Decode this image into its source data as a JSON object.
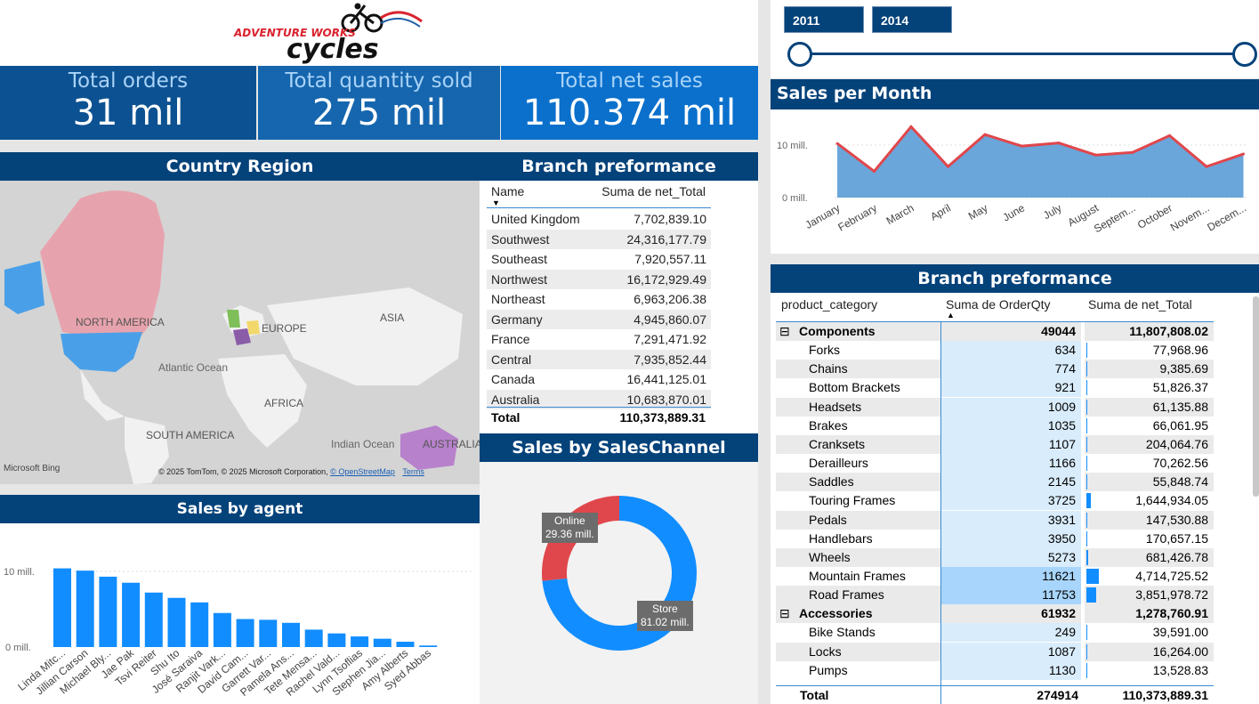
{
  "logo": {
    "line1": "ADVENTURE WORKS",
    "line2": "cycles"
  },
  "kpis": [
    {
      "title": "Total orders",
      "value": "31 mil"
    },
    {
      "title": "Total quantity sold",
      "value": "275 mil"
    },
    {
      "title": "Total net sales",
      "value": "110.374 mil"
    }
  ],
  "map": {
    "title": "Country Region",
    "labels": [
      "NORTH AMERICA",
      "EUROPE",
      "ASIA",
      "Atlantic Ocean",
      "AFRICA",
      "SOUTH AMERICA",
      "Indian Ocean",
      "AUSTRALIA"
    ],
    "bing": "Microsoft Bing",
    "copyright": "© 2025 TomTom, © 2025 Microsoft Corporation,",
    "osm": "© OpenStreetMap",
    "terms": "Terms"
  },
  "branch_table": {
    "title": "Branch preformance",
    "headers": [
      "Name",
      "Suma de net_Total"
    ],
    "rows": [
      [
        "United Kingdom",
        "7,702,839.10"
      ],
      [
        "Southwest",
        "24,316,177.79"
      ],
      [
        "Southeast",
        "7,920,557.11"
      ],
      [
        "Northwest",
        "16,172,929.49"
      ],
      [
        "Northeast",
        "6,963,206.38"
      ],
      [
        "Germany",
        "4,945,860.07"
      ],
      [
        "France",
        "7,291,471.92"
      ],
      [
        "Central",
        "7,935,852.44"
      ],
      [
        "Canada",
        "16,441,125.01"
      ],
      [
        "Australia",
        "10,683,870.01"
      ]
    ],
    "total_label": "Total",
    "total_value": "110,373,889.31"
  },
  "slicer": {
    "from": "2011",
    "to": "2014"
  },
  "agents": {
    "title": "Sales by agent",
    "ytick_top": "10 mill.",
    "ytick_bottom": "0 mill.",
    "names": [
      "Linda Mitc...",
      "Jillian Carson",
      "Michael Bly...",
      "Jae Pak",
      "Tsvi Reiter",
      "Shu Ito",
      "José Saraiva",
      "Ranjit Vark...",
      "David Cam...",
      "Garrett Var...",
      "Pamela Ans...",
      "Tete Mensa...",
      "Rachel Vald...",
      "Lynn Tsoflias",
      "Stephen Jia...",
      "Amy Alberts",
      "Syed Abbas"
    ]
  },
  "channel": {
    "title": "Sales by SalesChannel",
    "online_label": "Online",
    "online_value": "29.36 mill.",
    "store_label": "Store",
    "store_value": "81.02 mill."
  },
  "monthly": {
    "title": "Sales per Month",
    "ytick_top": "10 mill.",
    "ytick_bottom": "0 mill.",
    "months": [
      "January",
      "February",
      "March",
      "April",
      "May",
      "June",
      "July",
      "August",
      "Septem...",
      "October",
      "Novem...",
      "Decem..."
    ]
  },
  "category_table": {
    "title": "Branch preformance",
    "headers": [
      "product_category",
      "Suma de OrderQty",
      "Suma de net_Total"
    ],
    "groups": [
      {
        "name": "Components",
        "qty": "49044",
        "total": "11,807,808.02",
        "items": [
          [
            "Forks",
            "634",
            "77,968.96"
          ],
          [
            "Chains",
            "774",
            "9,385.69"
          ],
          [
            "Bottom Brackets",
            "921",
            "51,826.37"
          ],
          [
            "Headsets",
            "1009",
            "61,135.88"
          ],
          [
            "Brakes",
            "1035",
            "66,061.95"
          ],
          [
            "Cranksets",
            "1107",
            "204,064.76"
          ],
          [
            "Derailleurs",
            "1166",
            "70,262.56"
          ],
          [
            "Saddles",
            "2145",
            "55,848.74"
          ],
          [
            "Touring Frames",
            "3725",
            "1,644,934.05"
          ],
          [
            "Pedals",
            "3931",
            "147,530.88"
          ],
          [
            "Handlebars",
            "3950",
            "170,657.15"
          ],
          [
            "Wheels",
            "5273",
            "681,426.78"
          ],
          [
            "Mountain Frames",
            "11621",
            "4,714,725.52"
          ],
          [
            "Road Frames",
            "11753",
            "3,851,978.72"
          ]
        ]
      },
      {
        "name": "Accessories",
        "qty": "61932",
        "total": "1,278,760.91",
        "items": [
          [
            "Bike Stands",
            "249",
            "39,591.00"
          ],
          [
            "Locks",
            "1087",
            "16,264.00"
          ],
          [
            "Pumps",
            "1130",
            "13,528.83"
          ]
        ]
      }
    ],
    "total_label": "Total",
    "total_qty": "274914",
    "total_value": "110,373,889.31"
  },
  "chart_data": [
    {
      "type": "bar",
      "title": "Sales by agent",
      "categories": [
        "Linda Mitc...",
        "Jillian Carson",
        "Michael Bly...",
        "Jae Pak",
        "Tsvi Reiter",
        "Shu Ito",
        "José Saraiva",
        "Ranjit Vark...",
        "David Cam...",
        "Garrett Var...",
        "Pamela Ans...",
        "Tete Mensa...",
        "Rachel Vald...",
        "Lynn Tsoflias",
        "Stephen Jia...",
        "Amy Alberts",
        "Syed Abbas"
      ],
      "values": [
        10.4,
        10.1,
        9.3,
        8.5,
        7.2,
        6.5,
        5.9,
        4.5,
        3.7,
        3.6,
        3.2,
        2.3,
        1.8,
        1.4,
        1.1,
        0.7,
        0.2
      ],
      "ylim": [
        0,
        10
      ],
      "color": "#118dff"
    },
    {
      "type": "pie",
      "title": "Sales by SalesChannel",
      "categories": [
        "Online",
        "Store"
      ],
      "values": [
        29.36,
        81.02
      ],
      "colors": [
        "#e0474c",
        "#118dff"
      ]
    },
    {
      "type": "area",
      "title": "Sales per Month",
      "categories": [
        "January",
        "February",
        "March",
        "April",
        "May",
        "June",
        "July",
        "August",
        "Septem...",
        "October",
        "Novem...",
        "Decem..."
      ],
      "values": [
        10.3,
        5.0,
        13.5,
        5.9,
        12.0,
        9.8,
        10.4,
        8.1,
        8.6,
        11.8,
        5.9,
        8.3
      ],
      "ylim": [
        0,
        10
      ],
      "colors": [
        "#6aa6da",
        "#e0474c"
      ]
    }
  ]
}
